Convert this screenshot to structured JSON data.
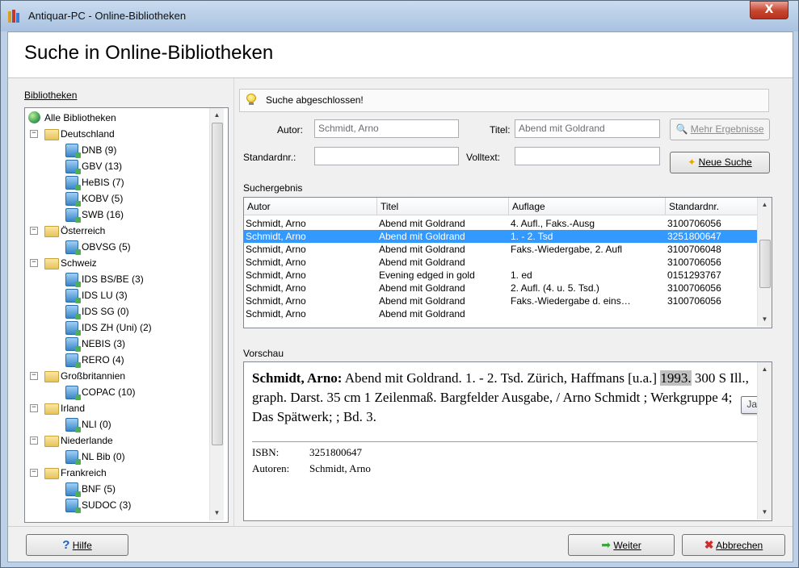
{
  "window": {
    "title": "Antiquar-PC - Online-Bibliotheken",
    "close_label": "X"
  },
  "header": {
    "title": "Suche in Online-Bibliotheken"
  },
  "sidebar": {
    "label": "Bibliotheken",
    "tree": [
      {
        "label": "Alle Bibliotheken",
        "type": "globe",
        "level": 0
      },
      {
        "label": "Deutschland",
        "type": "folder",
        "level": 1,
        "expander": "−"
      },
      {
        "label": "DNB (9)",
        "type": "db",
        "level": 2
      },
      {
        "label": "GBV (13)",
        "type": "db",
        "level": 2
      },
      {
        "label": "HeBIS (7)",
        "type": "db",
        "level": 2
      },
      {
        "label": "KOBV (5)",
        "type": "db",
        "level": 2
      },
      {
        "label": "SWB (16)",
        "type": "db",
        "level": 2
      },
      {
        "label": "Österreich",
        "type": "folder",
        "level": 1,
        "expander": "−"
      },
      {
        "label": "OBVSG (5)",
        "type": "db",
        "level": 2
      },
      {
        "label": "Schweiz",
        "type": "folder",
        "level": 1,
        "expander": "−"
      },
      {
        "label": "IDS BS/BE (3)",
        "type": "db",
        "level": 2
      },
      {
        "label": "IDS LU (3)",
        "type": "db",
        "level": 2
      },
      {
        "label": "IDS SG (0)",
        "type": "db",
        "level": 2
      },
      {
        "label": "IDS ZH (Uni) (2)",
        "type": "db",
        "level": 2
      },
      {
        "label": "NEBIS (3)",
        "type": "db",
        "level": 2
      },
      {
        "label": "RERO (4)",
        "type": "db",
        "level": 2
      },
      {
        "label": "Großbritannien",
        "type": "folder",
        "level": 1,
        "expander": "−"
      },
      {
        "label": "COPAC (10)",
        "type": "db",
        "level": 2
      },
      {
        "label": "Irland",
        "type": "folder",
        "level": 1,
        "expander": "−"
      },
      {
        "label": "NLI (0)",
        "type": "db",
        "level": 2
      },
      {
        "label": "Niederlande",
        "type": "folder",
        "level": 1,
        "expander": "−"
      },
      {
        "label": "NL Bib (0)",
        "type": "db",
        "level": 2
      },
      {
        "label": "Frankreich",
        "type": "folder",
        "level": 1,
        "expander": "−"
      },
      {
        "label": "BNF (5)",
        "type": "db",
        "level": 2
      },
      {
        "label": "SUDOC (3)",
        "type": "db",
        "level": 2
      }
    ]
  },
  "status": {
    "text": "Suche abgeschlossen!"
  },
  "search": {
    "author_label": "Autor:",
    "author_value": "Schmidt, Arno",
    "title_label": "Titel:",
    "title_value": "Abend mit Goldrand",
    "std_label": "Standardnr.:",
    "std_value": "",
    "fulltext_label": "Volltext:",
    "fulltext_value": "",
    "more_button": "Mehr Ergebnisse",
    "new_button": "Neue Suche"
  },
  "results": {
    "label": "Suchergebnis",
    "columns": [
      "Autor",
      "Titel",
      "Auflage",
      "Standardnr."
    ],
    "selected_index": 1,
    "rows": [
      [
        "Schmidt, Arno",
        "Abend mit Goldrand",
        "4. Aufl., Faks.-Ausg",
        "3100706056"
      ],
      [
        "Schmidt, Arno",
        "Abend mit Goldrand",
        "1. - 2. Tsd",
        "3251800647"
      ],
      [
        "Schmidt, Arno",
        "Abend mit Goldrand",
        "Faks.-Wiedergabe, 2. Aufl",
        "3100706048"
      ],
      [
        "Schmidt, Arno",
        "Abend mit Goldrand",
        "",
        "3100706056"
      ],
      [
        "Schmidt, Arno",
        "Evening edged in gold",
        "1. ed",
        "0151293767"
      ],
      [
        "Schmidt, Arno",
        "Abend mit Goldrand",
        "2. Aufl. (4. u. 5. Tsd.)",
        "3100706056"
      ],
      [
        "Schmidt, Arno",
        "Abend mit Goldrand",
        "Faks.-Wiedergabe d. eins…",
        "3100706056"
      ],
      [
        "Schmidt, Arno",
        "Abend mit Goldrand",
        "",
        ""
      ]
    ]
  },
  "preview": {
    "label": "Vorschau",
    "author": "Schmidt, Arno:",
    "text_before_year": " Abend mit Goldrand. 1. - 2. Tsd. Zürich, Haffmans [u.a.] ",
    "year": "1993.",
    "text_after_year": " 300 S Ill., graph. Darst. 35 cm 1 Zeilenmaß. Bargfelder Ausgabe, / Arno Schmidt ; Werkgruppe 4; Das Spätwerk; ; Bd. 3.",
    "isbn_label": "ISBN:",
    "isbn_value": "3251800647",
    "authors_label": "Autoren:",
    "authors_value": "Schmidt, Arno",
    "tooltip": "Jahr"
  },
  "footer": {
    "help_button": "Hilfe",
    "next_button": "Weiter",
    "cancel_button": "Abbrechen"
  }
}
